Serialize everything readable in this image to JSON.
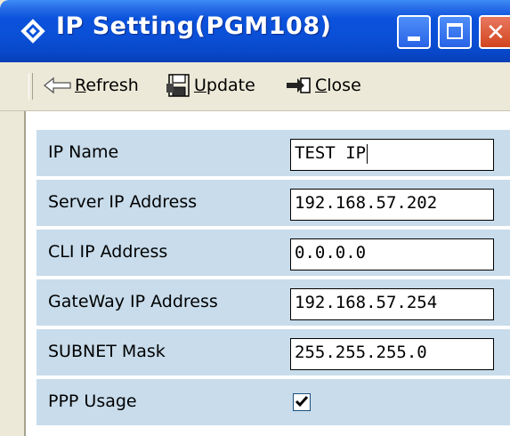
{
  "window": {
    "title": "IP Setting(PGM108)",
    "title_icon": "diamond-icon",
    "accent_color": "#0a4fd6"
  },
  "toolbar": {
    "refresh_rest": "efresh",
    "refresh_key": "R",
    "update_key": "U",
    "update_rest": "pdate",
    "close_key": "C",
    "close_rest": "lose"
  },
  "form": {
    "rows": [
      {
        "label": "IP Name",
        "value": "TEST IP"
      },
      {
        "label": "Server IP Address",
        "value": "192.168.57.202"
      },
      {
        "label": "CLI IP Address",
        "value": "0.0.0.0"
      },
      {
        "label": "GateWay IP Address",
        "value": "192.168.57.254"
      },
      {
        "label": "SUBNET Mask",
        "value": "255.255.255.0"
      }
    ],
    "ppp": {
      "label": "PPP Usage",
      "checked": true
    }
  },
  "colors": {
    "row_background": "#c8dceb"
  }
}
